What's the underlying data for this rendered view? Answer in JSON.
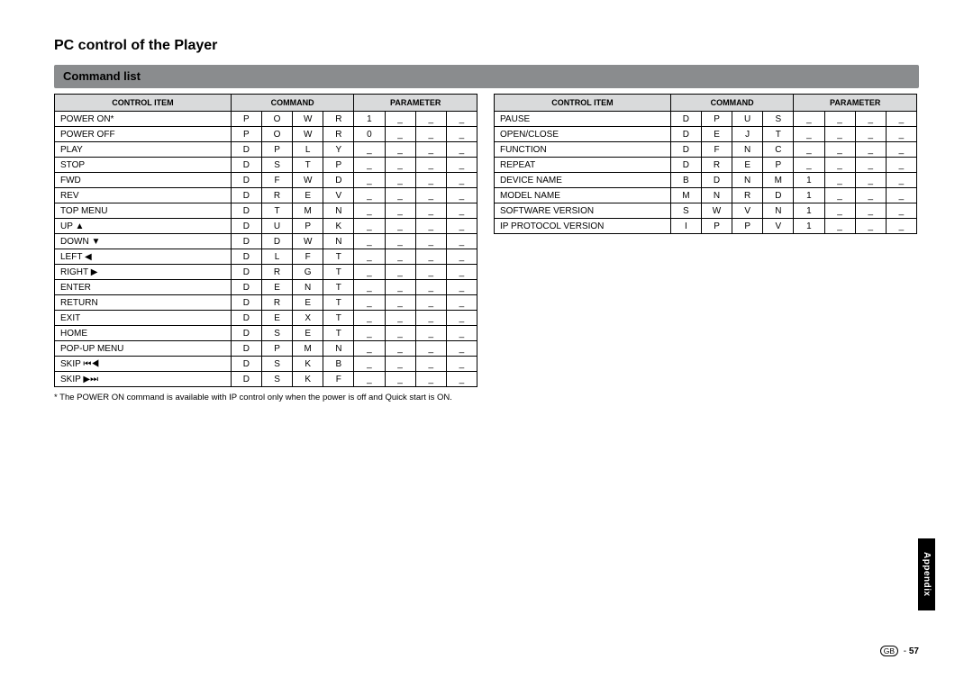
{
  "title": "PC control of the Player",
  "section": "Command list",
  "headers": {
    "control_item": "CONTROL ITEM",
    "command": "COMMAND",
    "parameter": "PARAMETER"
  },
  "table_left": [
    {
      "item": "POWER ON*",
      "chars": [
        "P",
        "O",
        "W",
        "R",
        "1",
        "_",
        "_",
        "_"
      ]
    },
    {
      "item": "POWER OFF",
      "chars": [
        "P",
        "O",
        "W",
        "R",
        "0",
        "_",
        "_",
        "_"
      ]
    },
    {
      "item": "PLAY",
      "chars": [
        "D",
        "P",
        "L",
        "Y",
        "_",
        "_",
        "_",
        "_"
      ]
    },
    {
      "item": "STOP",
      "chars": [
        "D",
        "S",
        "T",
        "P",
        "_",
        "_",
        "_",
        "_"
      ]
    },
    {
      "item": "FWD",
      "chars": [
        "D",
        "F",
        "W",
        "D",
        "_",
        "_",
        "_",
        "_"
      ]
    },
    {
      "item": "REV",
      "chars": [
        "D",
        "R",
        "E",
        "V",
        "_",
        "_",
        "_",
        "_"
      ]
    },
    {
      "item": "TOP MENU",
      "chars": [
        "D",
        "T",
        "M",
        "N",
        "_",
        "_",
        "_",
        "_"
      ]
    },
    {
      "item": "UP",
      "icon": "▲",
      "chars": [
        "D",
        "U",
        "P",
        "K",
        "_",
        "_",
        "_",
        "_"
      ]
    },
    {
      "item": "DOWN",
      "icon": "▼",
      "chars": [
        "D",
        "D",
        "W",
        "N",
        "_",
        "_",
        "_",
        "_"
      ]
    },
    {
      "item": "LEFT",
      "icon": "◀",
      "chars": [
        "D",
        "L",
        "F",
        "T",
        "_",
        "_",
        "_",
        "_"
      ]
    },
    {
      "item": "RIGHT",
      "icon": "▶",
      "chars": [
        "D",
        "R",
        "G",
        "T",
        "_",
        "_",
        "_",
        "_"
      ]
    },
    {
      "item": "ENTER",
      "chars": [
        "D",
        "E",
        "N",
        "T",
        "_",
        "_",
        "_",
        "_"
      ]
    },
    {
      "item": "RETURN",
      "chars": [
        "D",
        "R",
        "E",
        "T",
        "_",
        "_",
        "_",
        "_"
      ]
    },
    {
      "item": "EXIT",
      "chars": [
        "D",
        "E",
        "X",
        "T",
        "_",
        "_",
        "_",
        "_"
      ]
    },
    {
      "item": "HOME",
      "chars": [
        "D",
        "S",
        "E",
        "T",
        "_",
        "_",
        "_",
        "_"
      ]
    },
    {
      "item": "POP-UP MENU",
      "chars": [
        "D",
        "P",
        "M",
        "N",
        "_",
        "_",
        "_",
        "_"
      ]
    },
    {
      "item": "SKIP",
      "icon": "⏮◀",
      "chars": [
        "D",
        "S",
        "K",
        "B",
        "_",
        "_",
        "_",
        "_"
      ]
    },
    {
      "item": "SKIP",
      "icon": "▶⏭",
      "chars": [
        "D",
        "S",
        "K",
        "F",
        "_",
        "_",
        "_",
        "_"
      ]
    }
  ],
  "table_right": [
    {
      "item": "PAUSE",
      "chars": [
        "D",
        "P",
        "U",
        "S",
        "_",
        "_",
        "_",
        "_"
      ]
    },
    {
      "item": "OPEN/CLOSE",
      "chars": [
        "D",
        "E",
        "J",
        "T",
        "_",
        "_",
        "_",
        "_"
      ]
    },
    {
      "item": "FUNCTION",
      "chars": [
        "D",
        "F",
        "N",
        "C",
        "_",
        "_",
        "_",
        "_"
      ]
    },
    {
      "item": "REPEAT",
      "chars": [
        "D",
        "R",
        "E",
        "P",
        "_",
        "_",
        "_",
        "_"
      ]
    },
    {
      "item": "DEVICE NAME",
      "chars": [
        "B",
        "D",
        "N",
        "M",
        "1",
        "_",
        "_",
        "_"
      ]
    },
    {
      "item": "MODEL NAME",
      "chars": [
        "M",
        "N",
        "R",
        "D",
        "1",
        "_",
        "_",
        "_"
      ]
    },
    {
      "item": "SOFTWARE VERSION",
      "chars": [
        "S",
        "W",
        "V",
        "N",
        "1",
        "_",
        "_",
        "_"
      ]
    },
    {
      "item": "IP PROTOCOL VERSION",
      "chars": [
        "I",
        "P",
        "P",
        "V",
        "1",
        "_",
        "_",
        "_"
      ]
    }
  ],
  "footnote": "* The POWER ON command is available with IP control only when the power is off and Quick start is ON.",
  "sideTab": "Appendix",
  "pageNumber": {
    "prefix": "GB",
    "sep": " - ",
    "num": "57"
  }
}
